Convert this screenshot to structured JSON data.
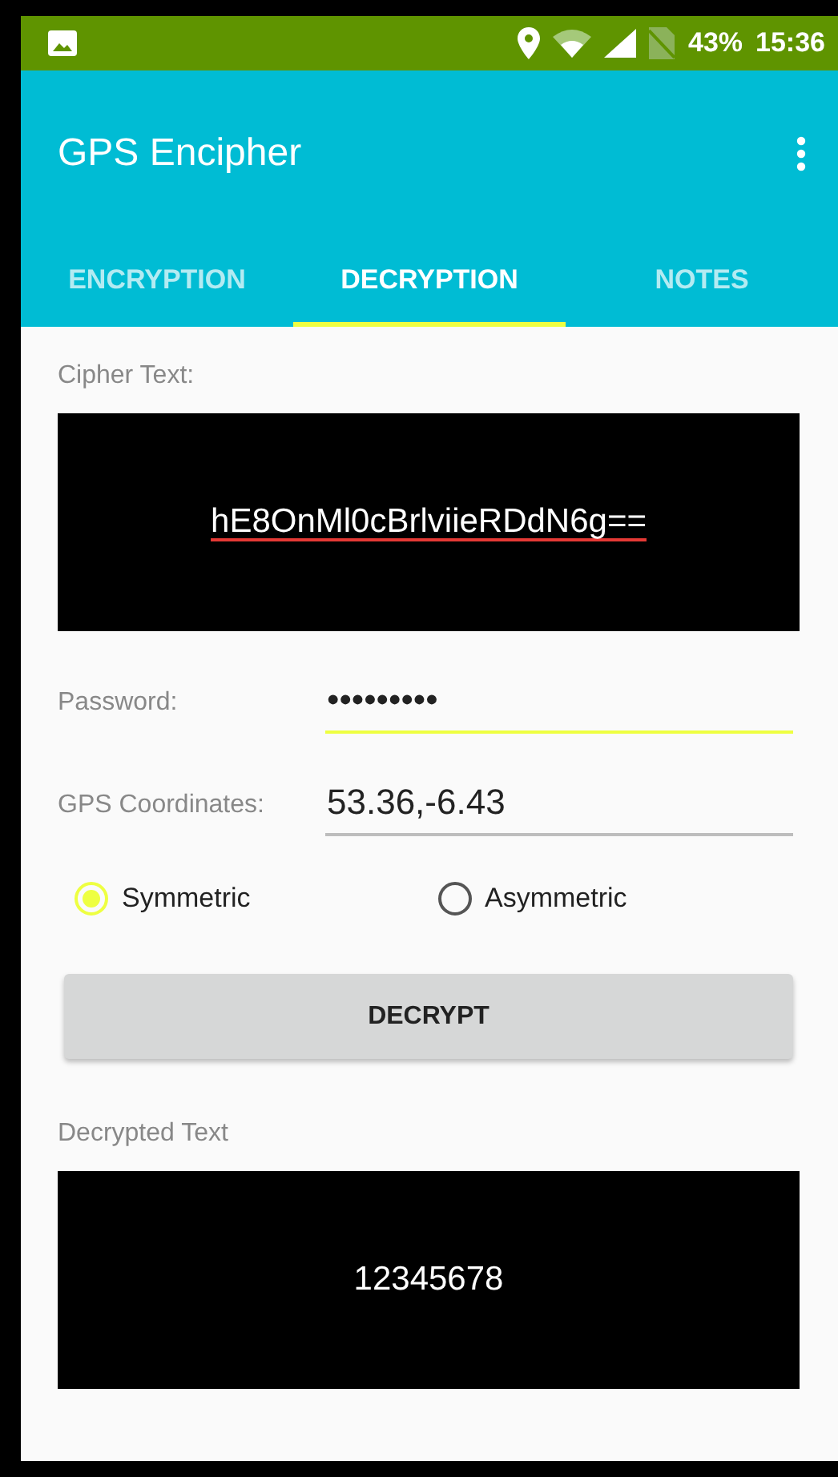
{
  "status_bar": {
    "battery": "43%",
    "time": "15:36"
  },
  "app_bar": {
    "title": "GPS Encipher"
  },
  "tabs": [
    {
      "label": "ENCRYPTION",
      "selected": false
    },
    {
      "label": "DECRYPTION",
      "selected": true
    },
    {
      "label": "NOTES",
      "selected": false
    }
  ],
  "cipher_text": {
    "label": "Cipher Text:",
    "value": "hE8OnMl0cBrlviieRDdN6g==",
    "spell_error": true
  },
  "password": {
    "label": "Password:",
    "value": "•••••••••",
    "focused": true
  },
  "gps": {
    "label": "GPS Coordinates:",
    "value": "53.36,-6.43",
    "focused": false
  },
  "key_types": [
    {
      "label": "Symmetric",
      "selected": true
    },
    {
      "label": "Asymmetric",
      "selected": false
    }
  ],
  "decrypt_button": {
    "label": "DECRYPT"
  },
  "decrypted_text": {
    "label": "Decrypted Text",
    "value": "12345678"
  }
}
